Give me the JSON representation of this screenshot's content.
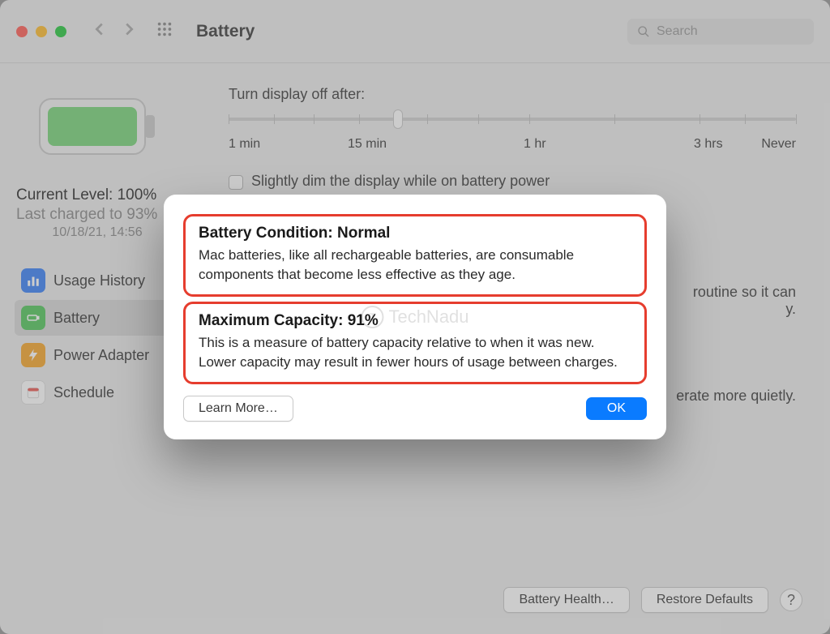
{
  "window": {
    "title": "Battery",
    "search_placeholder": "Search"
  },
  "sidebar": {
    "current_level": "Current Level: 100%",
    "last_charged": "Last charged to 93%",
    "timestamp": "10/18/21, 14:56",
    "items": [
      {
        "label": "Usage History"
      },
      {
        "label": "Battery"
      },
      {
        "label": "Power Adapter"
      },
      {
        "label": "Schedule"
      }
    ]
  },
  "main": {
    "display_off_label": "Turn display off after:",
    "slider_labels": [
      "1 min",
      "15 min",
      "1 hr",
      "3 hrs",
      "Never"
    ],
    "checkbox1": "Slightly dim the display while on battery power",
    "partial_text1": "routine so it can",
    "partial_text2": "erate more quietly.",
    "btn_health": "Battery Health…",
    "btn_restore": "Restore Defaults"
  },
  "dialog": {
    "condition_title": "Battery Condition: Normal",
    "condition_body": "Mac batteries, like all rechargeable batteries, are consumable components that become less effective as they age.",
    "capacity_title": "Maximum Capacity: 91%",
    "capacity_body": "This is a measure of battery capacity relative to when it was new. Lower capacity may result in fewer hours of usage between charges.",
    "learn_more": "Learn More…",
    "ok": "OK"
  },
  "watermark": "TechNadu"
}
